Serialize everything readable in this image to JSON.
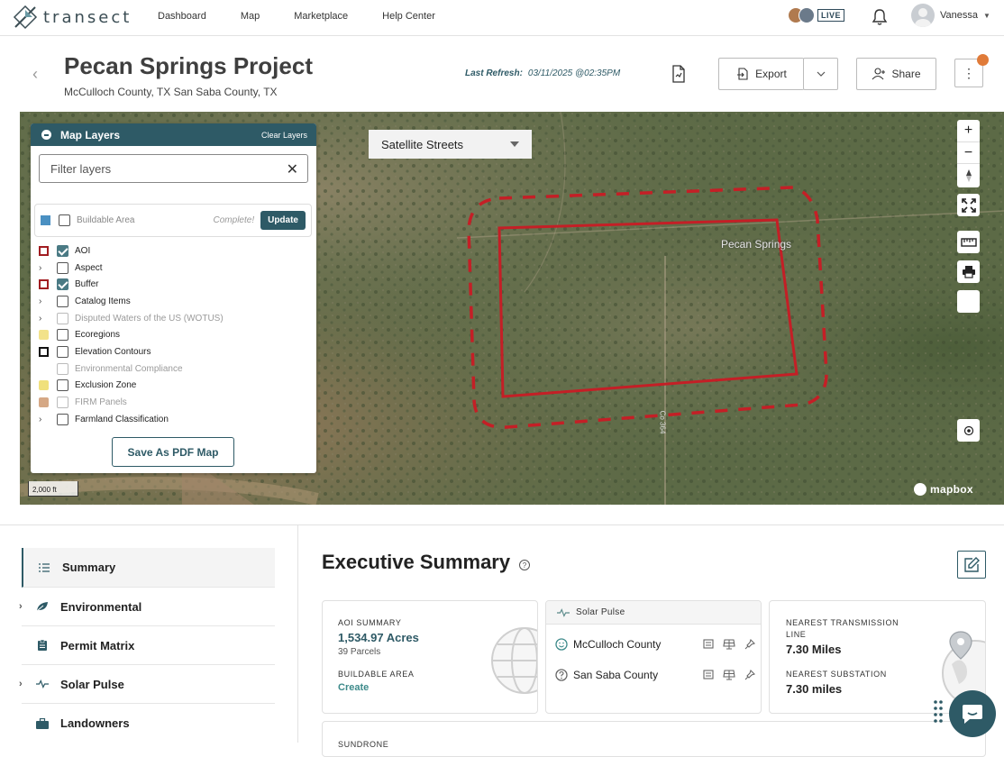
{
  "nav": {
    "logo_text": "transect",
    "links": [
      "Dashboard",
      "Map",
      "Marketplace",
      "Help Center"
    ],
    "live_label": "LIVE",
    "user_name": "Vanessa"
  },
  "project": {
    "title": "Pecan Springs Project",
    "location": "McCulloch County, TX San Saba County, TX",
    "refresh_label": "Last Refresh:",
    "refresh_value": "03/11/2025 @02:35PM",
    "export_label": "Export",
    "share_label": "Share"
  },
  "map": {
    "style_select": "Satellite Streets",
    "aoi_label": "Pecan Springs",
    "road_label": "Co 364",
    "scale_label": "2,000 ft",
    "attribution": "mapbox",
    "controls": [
      "+",
      "−"
    ]
  },
  "layers": {
    "title": "Map Layers",
    "clear_label": "Clear Layers",
    "filter_placeholder": "Filter layers",
    "buildable": {
      "label": "Buildable Area",
      "status": "Complete!",
      "button": "Update",
      "color": "#4a90c2"
    },
    "items": [
      {
        "label": "AOI",
        "checked": true,
        "expandable": false,
        "disabled": false,
        "legend": "aoi"
      },
      {
        "label": "Aspect",
        "checked": false,
        "expandable": true,
        "disabled": false,
        "legend": "none"
      },
      {
        "label": "Buffer",
        "checked": true,
        "expandable": false,
        "disabled": false,
        "legend": "buffer"
      },
      {
        "label": "Catalog Items",
        "checked": false,
        "expandable": true,
        "disabled": false,
        "legend": "none"
      },
      {
        "label": "Disputed Waters of the US (WOTUS)",
        "checked": false,
        "expandable": true,
        "disabled": true,
        "legend": "none"
      },
      {
        "label": "Ecoregions",
        "checked": false,
        "expandable": false,
        "disabled": false,
        "legend": "eco"
      },
      {
        "label": "Elevation Contours",
        "checked": false,
        "expandable": false,
        "disabled": false,
        "legend": "elev"
      },
      {
        "label": "Environmental Compliance",
        "checked": false,
        "expandable": false,
        "disabled": true,
        "legend": "none"
      },
      {
        "label": "Exclusion Zone",
        "checked": false,
        "expandable": false,
        "disabled": false,
        "legend": "excl"
      },
      {
        "label": "FIRM Panels",
        "checked": false,
        "expandable": false,
        "disabled": true,
        "legend": "firm"
      },
      {
        "label": "Farmland Classification",
        "checked": false,
        "expandable": true,
        "disabled": false,
        "legend": "none"
      }
    ],
    "pdf_button": "Save As PDF Map"
  },
  "sidebar": {
    "items": [
      {
        "label": "Summary",
        "icon": "list-icon",
        "active": true,
        "expandable": false
      },
      {
        "label": "Environmental",
        "icon": "leaf-icon",
        "active": false,
        "expandable": true
      },
      {
        "label": "Permit Matrix",
        "icon": "clipboard-icon",
        "active": false,
        "expandable": false
      },
      {
        "label": "Solar Pulse",
        "icon": "pulse-icon",
        "active": false,
        "expandable": true
      },
      {
        "label": "Landowners",
        "icon": "briefcase-icon",
        "active": false,
        "expandable": false
      }
    ]
  },
  "summary": {
    "title": "Executive Summary",
    "aoi_summary_label": "AOI SUMMARY",
    "acres": "1,534.97 Acres",
    "parcels": "39 Parcels",
    "buildable_label": "BUILDABLE AREA",
    "buildable_link": "Create",
    "solar_pulse_label": "Solar Pulse",
    "counties": [
      {
        "name": "McCulloch County",
        "status_icon": "smile-icon"
      },
      {
        "name": "San Saba County",
        "status_icon": "question-icon"
      }
    ],
    "transmission_label_1": "NEAREST TRANSMISSION",
    "transmission_label_2": "LINE",
    "transmission_value": "7.30 Miles",
    "substation_label": "NEAREST SUBSTATION",
    "substation_value": "7.30 miles",
    "next_card_label": "SUNDRONE"
  },
  "colors": {
    "brand": "#2e5a66",
    "aoi": "#c41f26",
    "accent": "#e07b39"
  }
}
